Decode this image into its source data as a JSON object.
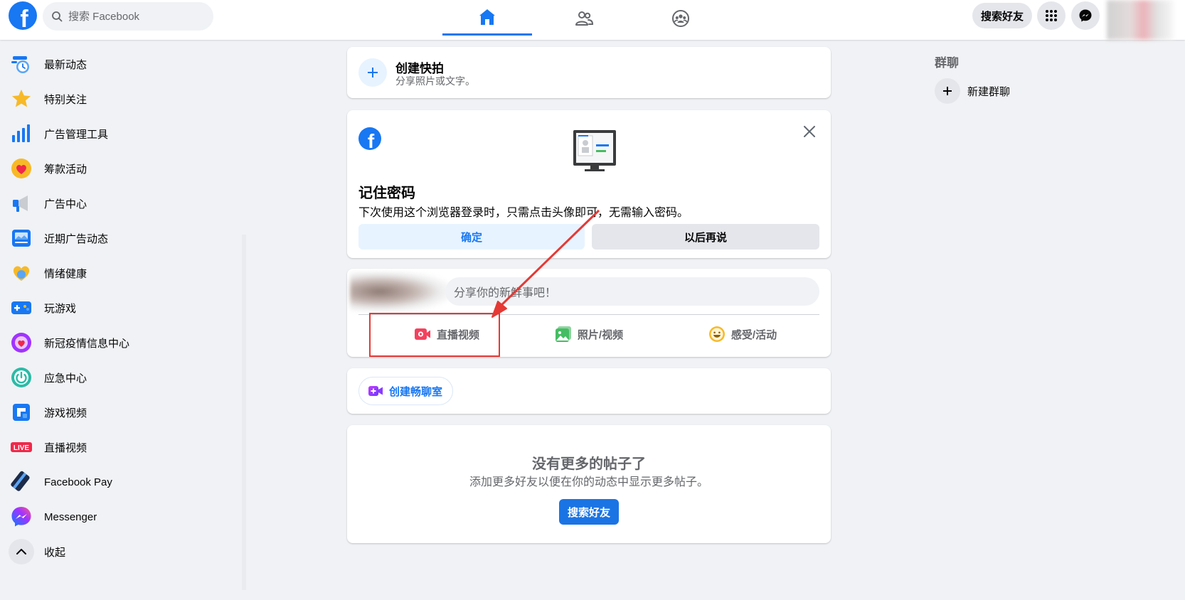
{
  "topbar": {
    "logo_letter": "f",
    "search_placeholder": "搜索 Facebook",
    "tabs": [
      {
        "name": "home",
        "icon": "home-icon",
        "active": true
      },
      {
        "name": "friends",
        "icon": "friends-icon",
        "active": false
      },
      {
        "name": "groups",
        "icon": "groups-icon",
        "active": false
      }
    ],
    "find_friends_label": "搜索好友",
    "menu_icon": "grid-menu-icon",
    "messenger_icon": "messenger-icon"
  },
  "sidebar": {
    "items": [
      {
        "label": "最新动态",
        "icon": "recent-feed-icon"
      },
      {
        "label": "特别关注",
        "icon": "star-icon"
      },
      {
        "label": "广告管理工具",
        "icon": "ads-manager-icon"
      },
      {
        "label": "筹款活动",
        "icon": "fundraiser-heart-icon"
      },
      {
        "label": "广告中心",
        "icon": "megaphone-icon"
      },
      {
        "label": "近期广告动态",
        "icon": "recent-ads-icon"
      },
      {
        "label": "情绪健康",
        "icon": "emotional-health-icon"
      },
      {
        "label": "玩游戏",
        "icon": "gamepad-icon"
      },
      {
        "label": "新冠疫情信息中心",
        "icon": "covid-info-icon"
      },
      {
        "label": "应急中心",
        "icon": "crisis-response-icon"
      },
      {
        "label": "游戏视频",
        "icon": "gaming-video-icon"
      },
      {
        "label": "直播视频",
        "icon": "live-badge-icon",
        "badge": "LIVE"
      },
      {
        "label": "Facebook Pay",
        "icon": "facebook-pay-icon"
      },
      {
        "label": "Messenger",
        "icon": "messenger-sidebar-icon"
      }
    ],
    "collapse_label": "收起"
  },
  "story": {
    "title": "创建快拍",
    "subtitle": "分享照片或文字。"
  },
  "password_card": {
    "title": "记住密码",
    "description": "下次使用这个浏览器登录时，只需点击头像即可，无需输入密码。",
    "ok_label": "确定",
    "later_label": "以后再说"
  },
  "composer": {
    "placeholder": "分享你的新鲜事吧！",
    "actions": [
      {
        "label": "直播视频",
        "icon": "live-video-icon",
        "color": "#f3425f"
      },
      {
        "label": "照片/视频",
        "icon": "photo-video-icon",
        "color": "#45bd62"
      },
      {
        "label": "感受/活动",
        "icon": "feeling-icon",
        "color": "#f7b928"
      }
    ]
  },
  "rooms": {
    "label": "创建畅聊室"
  },
  "empty_feed": {
    "title": "没有更多的帖子了",
    "subtitle": "添加更多好友以便在你的动态中显示更多帖子。",
    "button_label": "搜索好友"
  },
  "right_column": {
    "group_title": "群聊",
    "new_group_label": "新建群聊"
  },
  "colors": {
    "brand": "#1877f2",
    "background": "#f0f2f5",
    "annotation": "#e53935"
  }
}
